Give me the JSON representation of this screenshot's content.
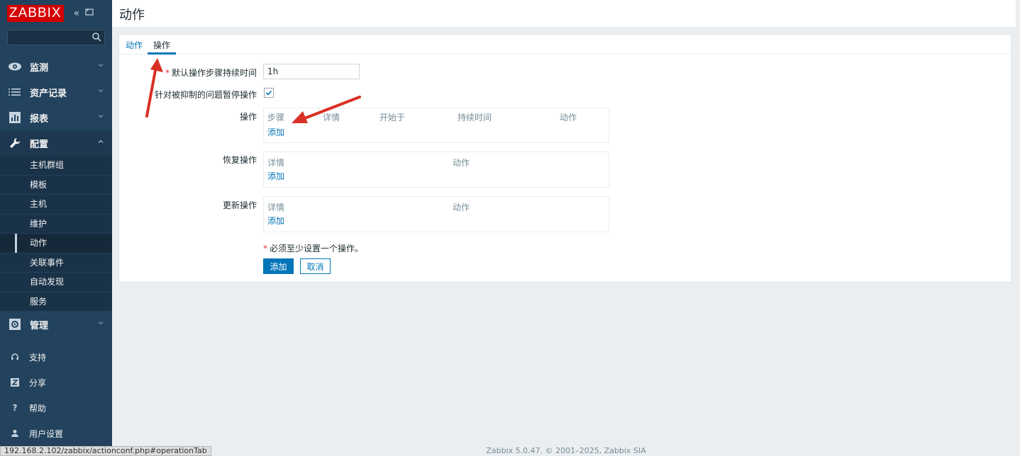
{
  "app": {
    "logo": "ZABBIX",
    "title": "动作"
  },
  "sidebar": {
    "search_placeholder": "",
    "menu": [
      {
        "label": "监测",
        "icon": "eye-icon"
      },
      {
        "label": "资产记录",
        "icon": "list-icon"
      },
      {
        "label": "报表",
        "icon": "bar-chart-icon"
      },
      {
        "label": "配置",
        "icon": "wrench-icon"
      },
      {
        "label": "管理",
        "icon": "gear-icon"
      }
    ],
    "submenu": [
      "主机群组",
      "模板",
      "主机",
      "维护",
      "动作",
      "关联事件",
      "自动发现",
      "服务"
    ],
    "bottom": [
      {
        "label": "支持",
        "icon": "headset-icon"
      },
      {
        "label": "分享",
        "icon": "share-icon"
      },
      {
        "label": "帮助",
        "icon": "help-icon"
      },
      {
        "label": "用户设置",
        "icon": "user-icon"
      }
    ]
  },
  "tabs": [
    {
      "label": "动作"
    },
    {
      "label": "操作"
    }
  ],
  "form": {
    "default_step_label": "默认操作步骤持续时间",
    "default_step_value": "1h",
    "pause_label": "针对被抑制的问题暂停操作",
    "operations_label": "操作",
    "operations_headers": [
      "步骤",
      "详情",
      "开始于",
      "持续时间",
      "动作"
    ],
    "recovery_label": "恢复操作",
    "recovery_headers": [
      "详情",
      "动作"
    ],
    "update_label": "更新操作",
    "update_headers": [
      "详情",
      "动作"
    ],
    "add_link": "添加",
    "note": "必须至少设置一个操作。",
    "add_button": "添加",
    "cancel_button": "取消"
  },
  "footer": "Zabbix 5.0.47. © 2001–2025, Zabbix SIA",
  "status_url": "192.168.2.102/zabbix/actionconf.php#operationTab",
  "colors": {
    "sidebar": "#22425d",
    "accent": "#0275b8",
    "logo": "#d40000",
    "annotation_arrow": "#d93025"
  }
}
